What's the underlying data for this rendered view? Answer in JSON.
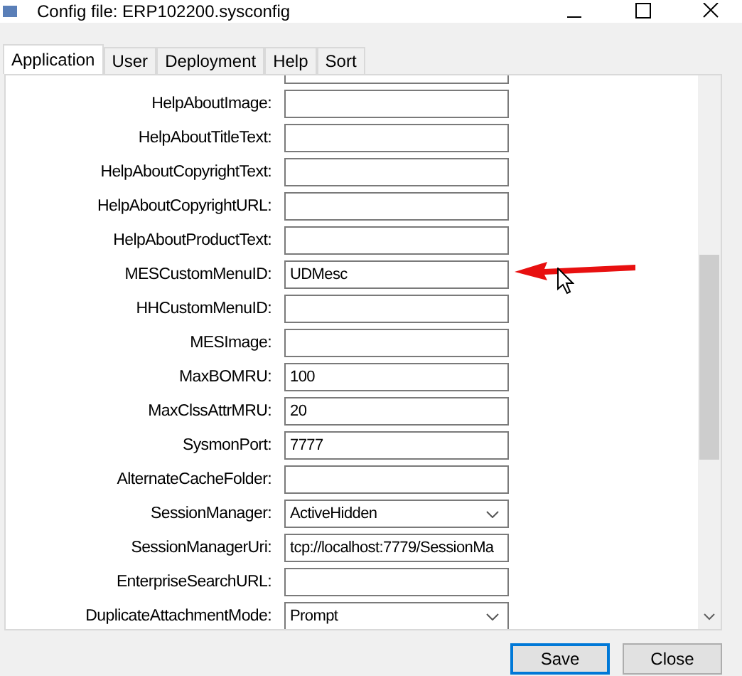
{
  "window": {
    "title": "Config file: ERP102200.sysconfig"
  },
  "tabs": [
    {
      "label": "Application",
      "selected": true
    },
    {
      "label": "User",
      "selected": false
    },
    {
      "label": "Deployment",
      "selected": false
    },
    {
      "label": "Help",
      "selected": false
    },
    {
      "label": "Sort",
      "selected": false
    }
  ],
  "fields": [
    {
      "label": "HelpAboutImage:",
      "kind": "text"
    },
    {
      "label": "HelpAboutTitleText:",
      "kind": "text"
    },
    {
      "label": "HelpAboutCopyrightText:",
      "kind": "text"
    },
    {
      "label": "HelpAboutCopyrightURL:",
      "kind": "text"
    },
    {
      "label": "HelpAboutProductText:",
      "kind": "text"
    },
    {
      "label": "MESCustomMenuID:",
      "kind": "text",
      "value": "UDMesc"
    },
    {
      "label": "HHCustomMenuID:",
      "kind": "text"
    },
    {
      "label": "MESImage:",
      "kind": "text"
    },
    {
      "label": "MaxBOMRU:",
      "kind": "text",
      "value": "100"
    },
    {
      "label": "MaxClssAttrMRU:",
      "kind": "text",
      "value": "20"
    },
    {
      "label": "SysmonPort:",
      "kind": "text",
      "value": "7777"
    },
    {
      "label": "AlternateCacheFolder:",
      "kind": "text"
    },
    {
      "label": "SessionManager:",
      "kind": "dropdown",
      "value": "ActiveHidden"
    },
    {
      "label": "SessionManagerUri:",
      "kind": "text",
      "value": "tcp://localhost:7779/SessionMa"
    },
    {
      "label": "EnterpriseSearchURL:",
      "kind": "text"
    },
    {
      "label": "DuplicateAttachmentMode:",
      "kind": "dropdown",
      "value": "Prompt"
    }
  ],
  "buttons": [
    {
      "label": "Save",
      "selected": true
    },
    {
      "label": "Close",
      "selected": false
    }
  ]
}
